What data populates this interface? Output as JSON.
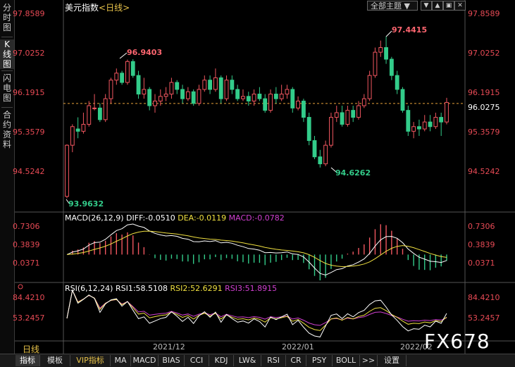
{
  "sidebar": {
    "tabs": [
      {
        "label": "分时图",
        "active": false
      },
      {
        "label": "K线图",
        "active": true
      },
      {
        "label": "闪电图",
        "active": false
      },
      {
        "label": "合约资料",
        "active": false
      }
    ]
  },
  "header": {
    "title": "美元指数",
    "period": "<日线>",
    "theme_select": "全部主题",
    "theme_arrow": "▼",
    "buttons": [
      "▼",
      "▲",
      "▣",
      "✕"
    ]
  },
  "price_axis": {
    "labels": [
      "97.8589",
      "97.0252",
      "96.1915",
      "95.3579",
      "94.5242"
    ],
    "current_price": "96.0275"
  },
  "annotations": {
    "high_1": "96.9403",
    "high_2": "97.4415",
    "low_1": "93.9632",
    "low_2": "94.6262"
  },
  "macd": {
    "title": "MACD(26,12,9)",
    "diff": "DIFF:-0.0510",
    "dea": "DEA:-0.0119",
    "macd": "MACD:-0.0782",
    "axis_labels": [
      "0.7306",
      "0.3839",
      "0.0371"
    ]
  },
  "rsi": {
    "title": "RSI(6,12,24)",
    "rsi1": "RSI1:58.5108",
    "rsi2": "RSI2:52.6291",
    "rsi3": "RSI3:51.8915",
    "axis_labels": [
      "84.4210",
      "53.2457"
    ]
  },
  "x_axis": {
    "labels": [
      "2021/12",
      "2022/01",
      "2022/02"
    ]
  },
  "period_label": "日线",
  "watermark": "FX678",
  "bottom_tabs": [
    "指标",
    "模板",
    "VIP指标",
    "MA",
    "MACD",
    "BIAS",
    "CCI",
    "KDJ",
    "LW&",
    "RSI",
    "CR",
    "PSY",
    "BOLL",
    ">>",
    "设置"
  ],
  "colors": {
    "up": "#f0565f",
    "down": "#33cc8a",
    "price_text": "#e84a55",
    "diff_line": "#ffffff",
    "dea_line": "#f0e040",
    "rsi3_line": "#d040d0"
  },
  "chart_data": {
    "type": "candlestick",
    "ylim": [
      93.8,
      97.95
    ],
    "candles": [
      [
        94.0,
        95.1,
        93.96,
        95.12
      ],
      [
        95.1,
        95.5,
        94.95,
        95.55
      ],
      [
        95.45,
        95.4,
        95.25,
        95.7
      ],
      [
        95.4,
        95.55,
        95.35,
        95.8
      ],
      [
        95.55,
        95.95,
        95.5,
        96.05
      ],
      [
        95.9,
        95.9,
        95.85,
        96.2
      ],
      [
        95.9,
        95.65,
        95.6,
        96.0
      ],
      [
        95.65,
        96.1,
        95.6,
        96.2
      ],
      [
        96.1,
        96.5,
        96.0,
        96.55
      ],
      [
        96.5,
        96.65,
        96.4,
        96.75
      ],
      [
        96.65,
        96.45,
        96.4,
        96.7
      ],
      [
        96.45,
        96.9,
        96.4,
        96.94
      ],
      [
        96.9,
        96.6,
        96.55,
        96.95
      ],
      [
        96.6,
        96.2,
        96.1,
        96.7
      ],
      [
        96.2,
        96.3,
        96.1,
        96.55
      ],
      [
        96.3,
        95.95,
        95.85,
        96.35
      ],
      [
        95.95,
        96.05,
        95.8,
        96.2
      ],
      [
        96.05,
        96.15,
        95.95,
        96.3
      ],
      [
        96.15,
        96.2,
        96.05,
        96.35
      ],
      [
        96.2,
        96.45,
        96.1,
        96.55
      ],
      [
        96.45,
        96.3,
        96.2,
        96.5
      ],
      [
        96.3,
        96.1,
        96.0,
        96.4
      ],
      [
        96.1,
        96.25,
        96.05,
        96.35
      ],
      [
        96.25,
        96.0,
        95.95,
        96.3
      ],
      [
        96.0,
        96.3,
        95.95,
        96.4
      ],
      [
        96.3,
        96.5,
        96.25,
        96.6
      ],
      [
        96.5,
        96.3,
        96.2,
        96.6
      ],
      [
        96.3,
        96.55,
        96.25,
        96.75
      ],
      [
        96.55,
        96.1,
        96.0,
        96.6
      ],
      [
        96.1,
        96.5,
        96.05,
        96.6
      ],
      [
        96.5,
        96.3,
        96.2,
        96.6
      ],
      [
        96.3,
        96.1,
        96.05,
        96.4
      ],
      [
        96.1,
        96.15,
        96.05,
        96.3
      ],
      [
        96.15,
        96.05,
        95.95,
        96.25
      ],
      [
        96.05,
        96.2,
        95.95,
        96.3
      ],
      [
        96.2,
        96.1,
        96.05,
        96.35
      ],
      [
        96.1,
        95.85,
        95.8,
        96.2
      ],
      [
        95.85,
        96.2,
        95.8,
        96.3
      ],
      [
        96.2,
        96.1,
        96.0,
        96.35
      ],
      [
        96.1,
        96.2,
        96.05,
        96.4
      ],
      [
        96.2,
        96.3,
        96.1,
        96.4
      ],
      [
        96.3,
        95.9,
        95.8,
        96.35
      ],
      [
        95.9,
        96.05,
        95.85,
        96.15
      ],
      [
        96.05,
        95.7,
        95.6,
        96.1
      ],
      [
        95.7,
        95.2,
        95.1,
        95.8
      ],
      [
        95.2,
        94.85,
        94.8,
        95.3
      ],
      [
        94.85,
        94.7,
        94.62,
        95.0
      ],
      [
        94.7,
        95.1,
        94.65,
        95.2
      ],
      [
        95.1,
        95.7,
        95.05,
        95.8
      ],
      [
        95.7,
        95.8,
        95.6,
        95.95
      ],
      [
        95.8,
        95.55,
        95.5,
        95.95
      ],
      [
        95.55,
        95.85,
        95.5,
        95.95
      ],
      [
        95.85,
        95.7,
        95.6,
        95.95
      ],
      [
        95.7,
        95.95,
        95.65,
        96.05
      ],
      [
        95.95,
        96.1,
        95.9,
        96.2
      ],
      [
        96.1,
        96.6,
        96.05,
        96.7
      ],
      [
        96.6,
        97.1,
        96.55,
        97.2
      ],
      [
        97.1,
        97.2,
        97.0,
        97.35
      ],
      [
        97.2,
        96.95,
        96.85,
        97.44
      ],
      [
        96.95,
        96.6,
        96.5,
        97.0
      ],
      [
        96.6,
        96.3,
        96.2,
        96.7
      ],
      [
        96.3,
        95.85,
        95.8,
        96.35
      ],
      [
        95.85,
        95.4,
        95.3,
        95.95
      ],
      [
        95.4,
        95.5,
        95.25,
        95.6
      ],
      [
        95.5,
        95.45,
        95.3,
        95.65
      ],
      [
        95.45,
        95.6,
        95.4,
        95.75
      ],
      [
        95.6,
        95.5,
        95.4,
        95.75
      ],
      [
        95.5,
        95.7,
        95.45,
        95.8
      ],
      [
        95.7,
        95.6,
        95.3,
        95.8
      ],
      [
        95.6,
        96.02,
        95.55,
        96.12
      ]
    ]
  }
}
